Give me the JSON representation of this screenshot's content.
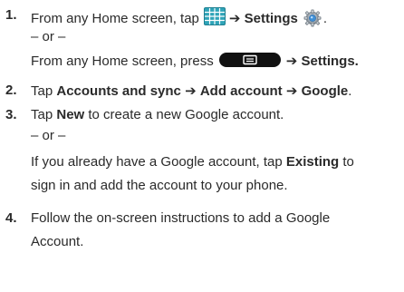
{
  "steps": [
    {
      "number": "1.",
      "line1_pre": "From any Home screen, tap",
      "line1_arrow": "➔",
      "line1_target": "Settings",
      "line1_end": ".",
      "or": "– or –",
      "line2_pre": "From any Home screen, press",
      "line2_arrow": "➔",
      "line2_target": "Settings."
    },
    {
      "number": "2.",
      "pre": "Tap",
      "item1": "Accounts and sync",
      "arrow1": "➔",
      "item2": "Add account",
      "arrow2": "➔",
      "item3": "Google",
      "end": "."
    },
    {
      "number": "3.",
      "pre": "Tap",
      "item": "New",
      "post": "to create a new Google account.",
      "or": "– or –",
      "alt_pre": "If you already have a Google account, tap",
      "alt_item": "Existing",
      "alt_post": "to",
      "alt_line2": "sign in and add the account to your phone."
    },
    {
      "number": "4.",
      "line1": "Follow the on-screen instructions to add a Google",
      "line2": "Account."
    }
  ],
  "icons": {
    "apps": "apps-grid-icon",
    "settings": "settings-gear-icon",
    "menu_key": "menu-key-icon"
  },
  "colors": {
    "text": "#2a2a2a",
    "apps_icon": "#2fa4b8",
    "menu_key": "#111111"
  }
}
